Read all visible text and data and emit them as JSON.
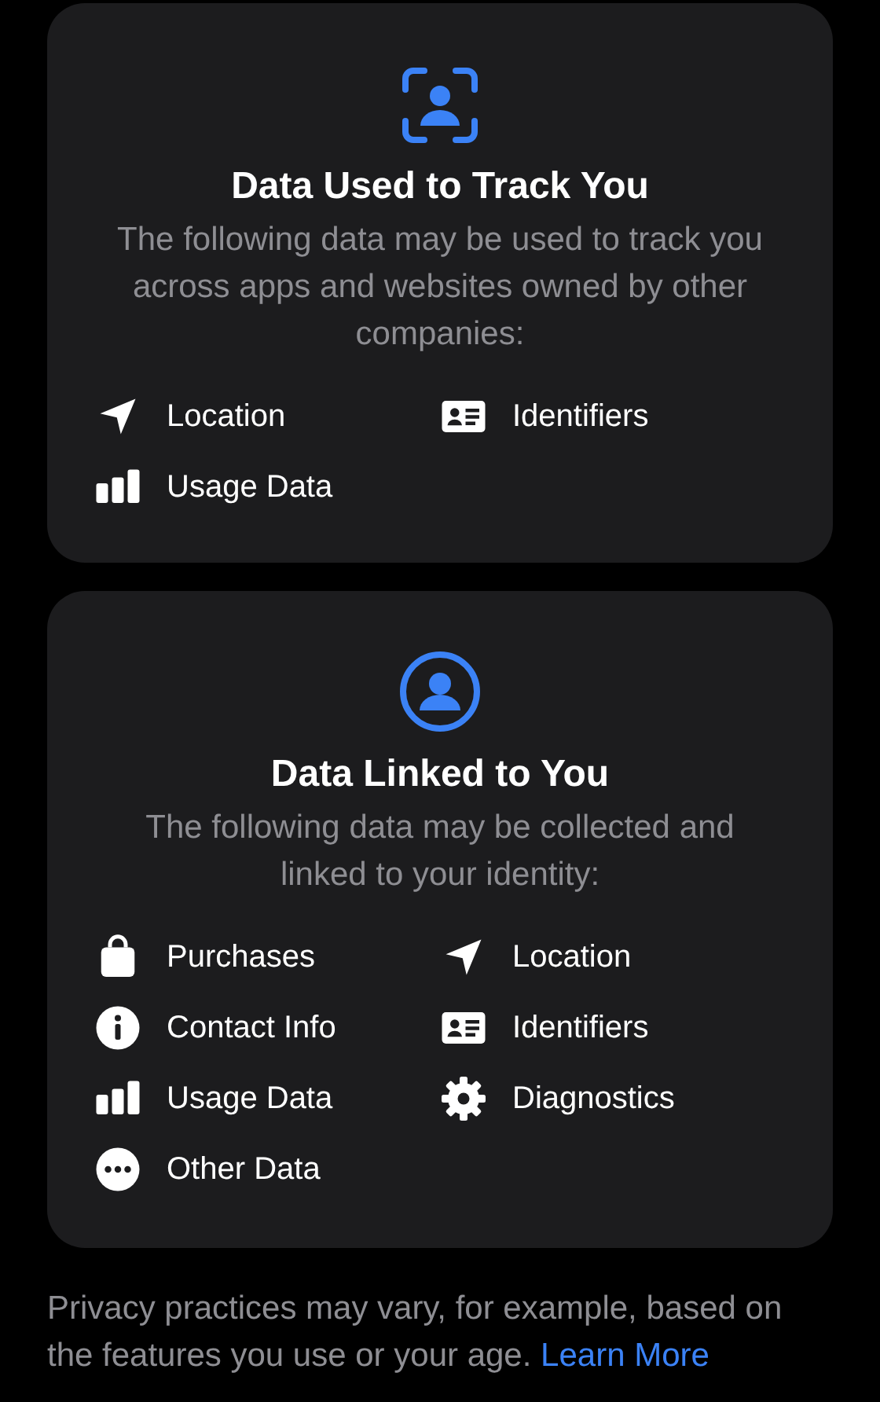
{
  "cards": [
    {
      "kind": "track",
      "title": "Data Used to Track You",
      "description": "The following data may be used to track you across apps and websites owned by other companies:",
      "items": [
        {
          "kind": "location",
          "label": "Location"
        },
        {
          "kind": "identifiers",
          "label": "Identifiers"
        },
        {
          "kind": "usage",
          "label": "Usage Data"
        }
      ]
    },
    {
      "kind": "linked",
      "title": "Data Linked to You",
      "description": "The following data may be collected and linked to your identity:",
      "items": [
        {
          "kind": "purchases",
          "label": "Purchases"
        },
        {
          "kind": "location",
          "label": "Location"
        },
        {
          "kind": "contact",
          "label": "Contact Info"
        },
        {
          "kind": "identifiers",
          "label": "Identifiers"
        },
        {
          "kind": "usage",
          "label": "Usage Data"
        },
        {
          "kind": "diagnostics",
          "label": "Diagnostics"
        },
        {
          "kind": "other",
          "label": "Other Data"
        }
      ]
    }
  ],
  "footer": {
    "text": "Privacy practices may vary, for example, based on the features you use or your age.",
    "link": "Learn More"
  }
}
